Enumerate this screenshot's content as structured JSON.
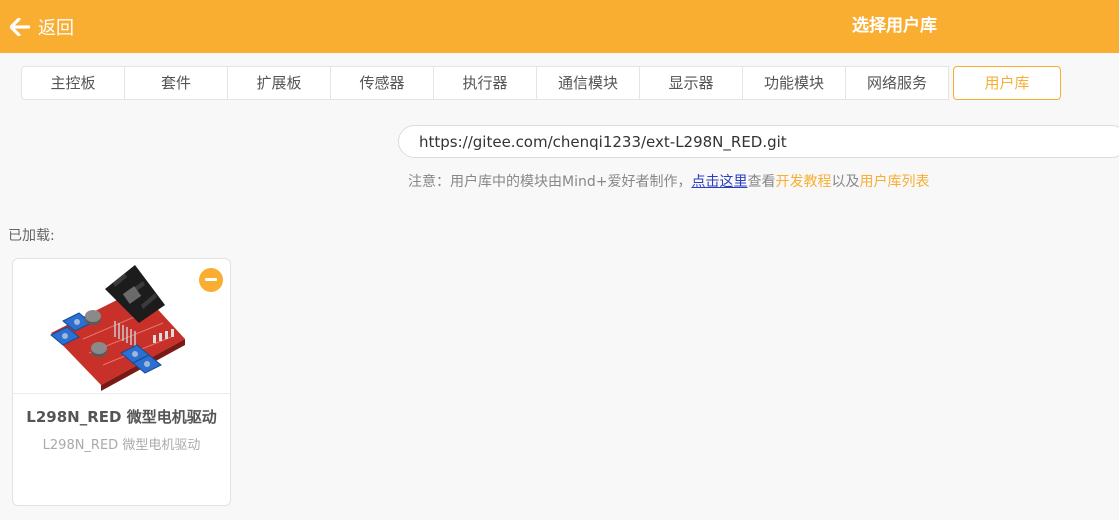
{
  "header": {
    "back_label": "返回",
    "title": "选择用户库"
  },
  "tabs": [
    {
      "label": "主控板"
    },
    {
      "label": "套件"
    },
    {
      "label": "扩展板"
    },
    {
      "label": "传感器"
    },
    {
      "label": "执行器"
    },
    {
      "label": "通信模块"
    },
    {
      "label": "显示器"
    },
    {
      "label": "功能模块"
    },
    {
      "label": "网络服务"
    },
    {
      "label": "用户库",
      "active": true
    }
  ],
  "search": {
    "value": "https://gitee.com/chenqi1233/ext-L298N_RED.git"
  },
  "note": {
    "prefix": "注意：用户库中的模块由Mind+爱好者制作，",
    "link": "点击这里",
    "middle1": "查看",
    "dev_tutorial": "开发教程",
    "middle2": "以及",
    "user_lib_list": "用户库列表"
  },
  "loaded": {
    "label": "已加载:",
    "items": [
      {
        "title": "L298N_RED 微型电机驱动",
        "subtitle": "L298N_RED 微型电机驱动",
        "image": "l298n-board-image"
      }
    ]
  },
  "colors": {
    "accent": "#f9ae32",
    "link": "#2a3ec4"
  }
}
